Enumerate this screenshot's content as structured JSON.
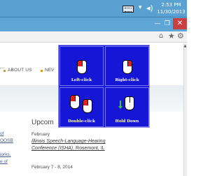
{
  "taskbar": {
    "keyboard_icon": "keyboard-icon",
    "arrow_icon": "chevron-up-icon",
    "volume_icon": "speaker-icon",
    "time": "2:53 PM",
    "date": "11/30/2013"
  },
  "window": {
    "minimize_icon": "minimize-icon",
    "maximize_icon": "maximize-icon",
    "close_icon": "close-icon",
    "close_color": "#c84040"
  },
  "browser": {
    "home_icon": "home-icon",
    "favorites_icon": "star-icon",
    "tools_icon": "gear-icon"
  },
  "page": {
    "nav": {
      "about_label": "ABOUT US",
      "news_label": "NEV",
      "bullet_color": "#d99a1c"
    },
    "left_links": [
      "of",
      "OOSB",
      "iorks,",
      "e of"
    ],
    "section_title": "Upcom",
    "events": [
      {
        "date": "February",
        "title": "Illinois Speech-Language-Hearing",
        "title_line2": "Conference (ISHA)",
        "location": ", Rosemont, IL"
      },
      {
        "date": "February 7 - 8, 2014"
      }
    ]
  },
  "mouse_panel": {
    "background": "#1a1adb",
    "highlight": "#e41e1e",
    "tiles": [
      {
        "label": "Left-click",
        "icon": "mouse-left-click-icon"
      },
      {
        "label": "Right-click",
        "icon": "mouse-right-click-icon"
      },
      {
        "label": "Double-click",
        "icon": "mouse-double-click-icon"
      },
      {
        "label": "Hold Down",
        "icon": "mouse-hold-down-icon"
      }
    ]
  }
}
